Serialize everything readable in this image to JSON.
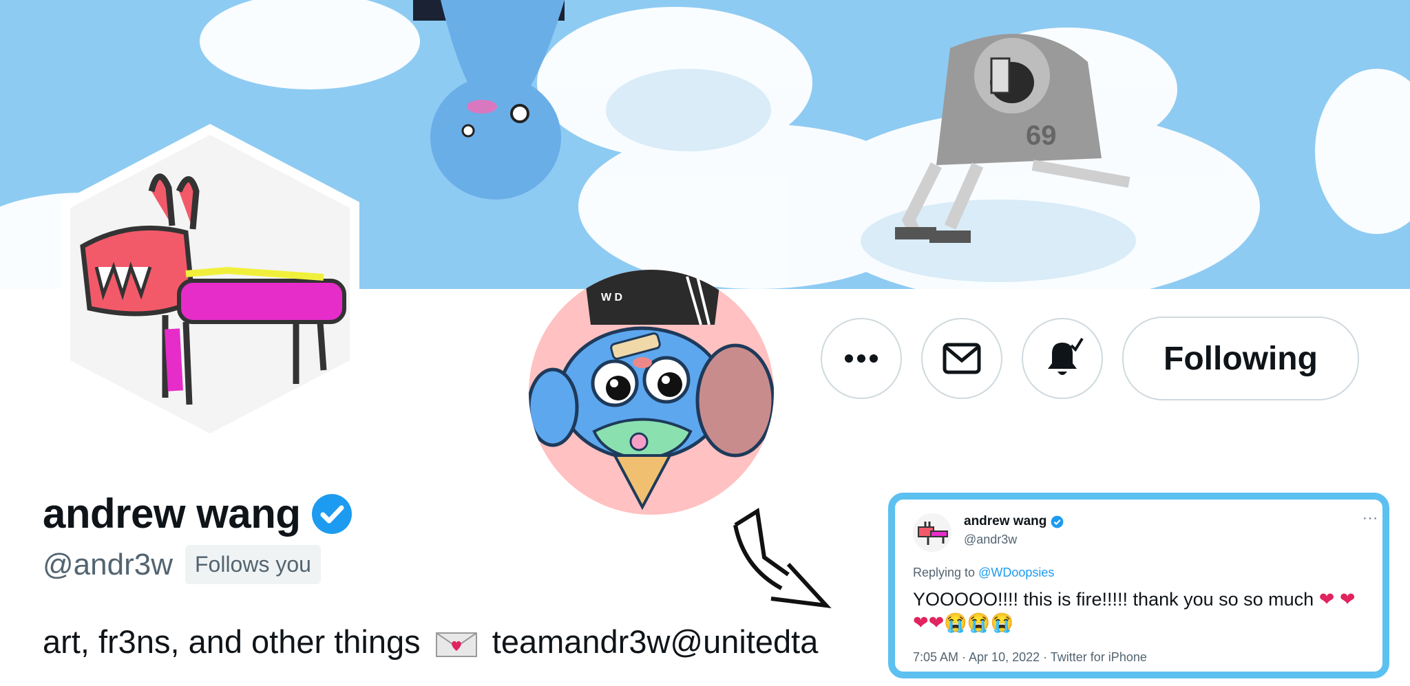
{
  "profile": {
    "display_name": "andrew wang",
    "handle": "@andr3w",
    "follows_you": "Follows you",
    "bio_text": "art, fr3ns, and other things",
    "bio_email": "teamandr3w@unitedta",
    "verified_icon": "verified-badge-icon"
  },
  "actions": {
    "more_icon": "more-icon",
    "message_icon": "mail-icon",
    "notify_icon": "bell-icon",
    "following_label": "Following"
  },
  "tweet": {
    "display_name": "andrew wang",
    "handle": "@andr3w",
    "replying_prefix": "Replying to",
    "replying_to": "@WDoopsies",
    "text": "YOOOOO!!!! this is fire!!!!! thank you so so much",
    "meta": "7:05 AM · Apr 10, 2022 · Twitter for iPhone",
    "more": "···"
  },
  "colors": {
    "banner_sky": "#8ecbf2",
    "card_border": "#5cc0f0",
    "verified_blue": "#1d9bf0",
    "pfp_bg": "#ffc1c1"
  }
}
